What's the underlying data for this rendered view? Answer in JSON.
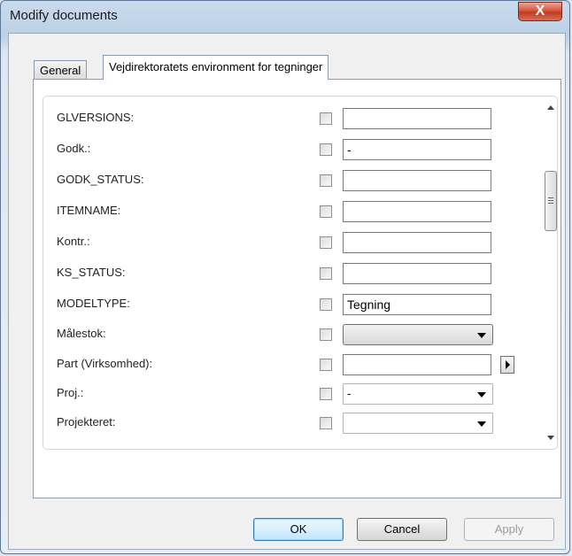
{
  "window": {
    "title": "Modify documents",
    "close_glyph": "X"
  },
  "tabs": [
    {
      "label": "General"
    },
    {
      "label": "Vejdirektoratets environment for tegninger"
    }
  ],
  "fields": [
    {
      "label": "GLVERSIONS:",
      "value": ""
    },
    {
      "label": "Godk.:",
      "value": "-"
    },
    {
      "label": "GODK_STATUS:",
      "value": ""
    },
    {
      "label": "ITEMNAME:",
      "value": ""
    },
    {
      "label": "Kontr.:",
      "value": ""
    },
    {
      "label": "KS_STATUS:",
      "value": ""
    },
    {
      "label": "MODELTYPE:",
      "value": "Tegning"
    },
    {
      "label": "Målestok:",
      "value": ""
    },
    {
      "label": "Part (Virksomhed):",
      "value": ""
    },
    {
      "label": "Proj.:",
      "value": "-"
    },
    {
      "label": "Projekteret:",
      "value": ""
    }
  ],
  "buttons": {
    "ok": "OK",
    "cancel": "Cancel",
    "apply": "Apply"
  }
}
